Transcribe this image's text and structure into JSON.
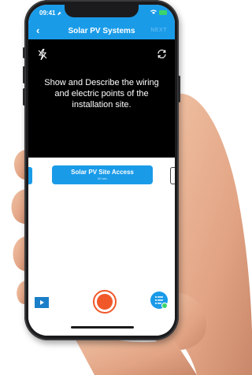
{
  "status_bar": {
    "time": "09:41",
    "location_glyph": "⬈"
  },
  "nav": {
    "back_glyph": "‹",
    "title": "Solar PV Systems",
    "next_label": "NEXT"
  },
  "camera": {
    "instruction": "Show and Describe the wiring and electric points of the installation site."
  },
  "card": {
    "title": "Solar PV Site Access",
    "subtitle": "60 sec"
  },
  "colors": {
    "accent": "#1a9be8",
    "record": "#f0582a",
    "badge": "#3cd46b",
    "camera_bg": "#000000"
  },
  "icons": [
    "flash-off-icon",
    "camera-flip-icon",
    "video-thumbnail-icon",
    "record-icon",
    "list-icon"
  ]
}
